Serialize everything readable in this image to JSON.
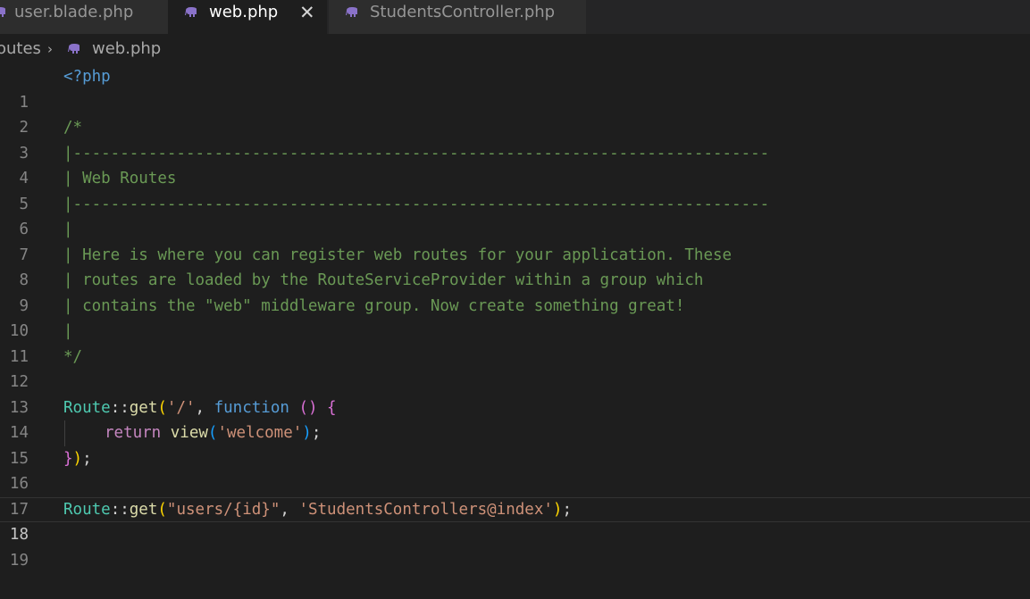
{
  "tabs": [
    {
      "label": "user.blade.php",
      "icon": "php-elephant-icon",
      "active": false
    },
    {
      "label": "web.php",
      "icon": "php-elephant-icon",
      "active": true,
      "close": "✕"
    },
    {
      "label": "StudentsController.php",
      "icon": "php-elephant-icon",
      "active": false
    }
  ],
  "breadcrumb": {
    "folder": "outes",
    "separator": "›",
    "file": "web.php"
  },
  "editor": {
    "line_numbers": [
      "1",
      "2",
      "3",
      "4",
      "5",
      "6",
      "7",
      "8",
      "9",
      "10",
      "11",
      "12",
      "13",
      "14",
      "15",
      "16",
      "17",
      "18",
      "19"
    ],
    "current_line": "18",
    "lines": {
      "l1": "<?php",
      "l3": "/*",
      "l4": "|--------------------------------------------------------------------------",
      "l5": "| Web Routes",
      "l6": "|--------------------------------------------------------------------------",
      "l7": "|",
      "l8": "| Here is where you can register web routes for your application. These",
      "l9": "| routes are loaded by the RouteServiceProvider within a group which",
      "l10": "| contains the \"web\" middleware group. Now create something great!",
      "l11": "|",
      "l12": "*/",
      "l14": {
        "class": "Route",
        "op": "::",
        "fn": "get",
        "open": "(",
        "arg": "'/'",
        "comma": ", ",
        "kw": "function",
        "params": " ()",
        "brace": " {"
      },
      "l15": {
        "kw": "return",
        "fn": "view",
        "open": "(",
        "arg": "'welcome'",
        "close": ")",
        "semi": ";"
      },
      "l16": {
        "brace": "}",
        "close": ")",
        "semi": ";"
      },
      "l18": {
        "class": "Route",
        "op": "::",
        "fn": "get",
        "open": "(",
        "arg1": "\"users/{id}\"",
        "comma": ", ",
        "arg2": "'StudentsControllers@index'",
        "close": ")",
        "semi": ";"
      }
    }
  },
  "colors": {
    "background": "#1e1e1e",
    "comment": "#6a9955",
    "keyword": "#569cd6",
    "class": "#4ec9b0",
    "function": "#dcdcaa",
    "string": "#ce9178",
    "php_icon": "#8a72c9"
  }
}
